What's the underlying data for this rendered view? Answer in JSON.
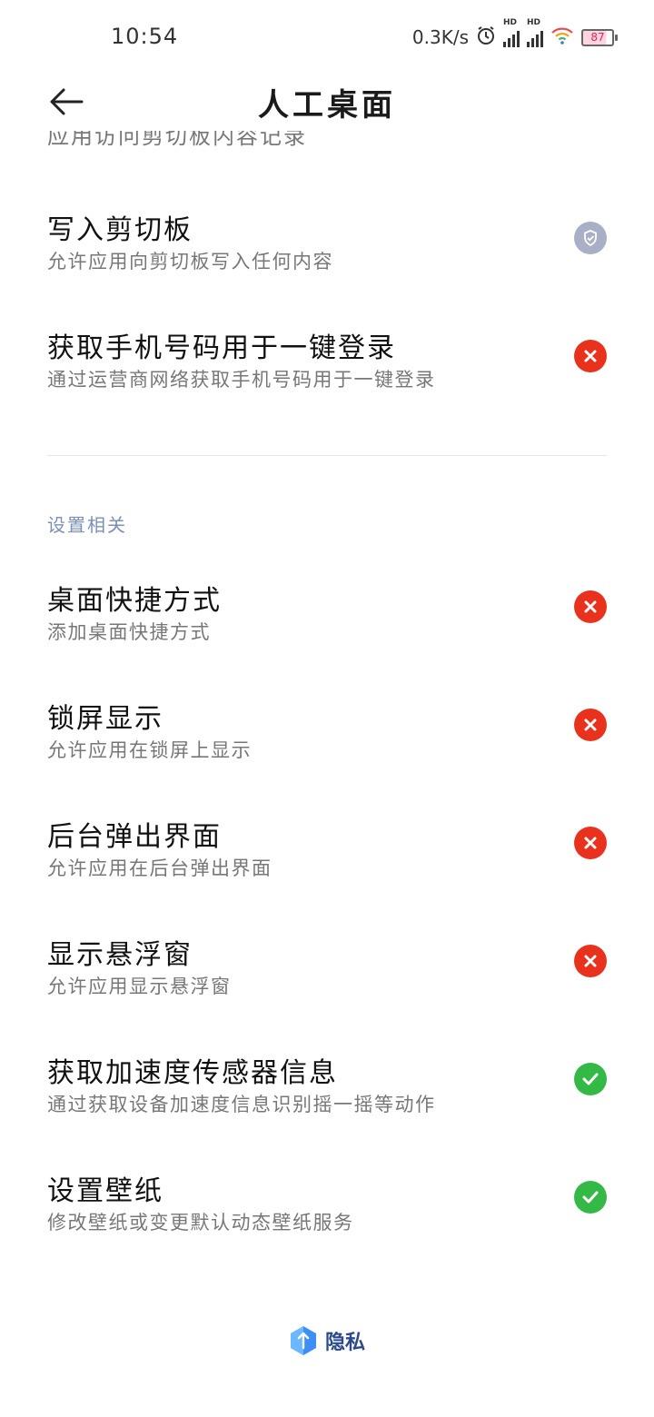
{
  "status_bar": {
    "time": "10:54",
    "net_speed": "0.3K/s",
    "signal_label": "HD",
    "battery": "87",
    "icons": [
      "alarm-icon",
      "signal-icon",
      "signal-icon",
      "wifi-icon",
      "battery-icon"
    ]
  },
  "header": {
    "back_icon": "arrow-left-icon",
    "title": "人工桌面"
  },
  "truncated_text": "应用访问剪切板内容记录",
  "permissions": [
    {
      "title": "写入剪切板",
      "subtitle": "允许应用向剪切板写入任何内容",
      "status": "ask"
    },
    {
      "title": "获取手机号码用于一键登录",
      "subtitle": "通过运营商网络获取手机号码用于一键登录",
      "status": "denied"
    }
  ],
  "section": {
    "label": "设置相关",
    "items": [
      {
        "title": "桌面快捷方式",
        "subtitle": "添加桌面快捷方式",
        "status": "denied"
      },
      {
        "title": "锁屏显示",
        "subtitle": "允许应用在锁屏上显示",
        "status": "denied"
      },
      {
        "title": "后台弹出界面",
        "subtitle": "允许应用在后台弹出界面",
        "status": "denied"
      },
      {
        "title": "显示悬浮窗",
        "subtitle": "允许应用显示悬浮窗",
        "status": "denied"
      },
      {
        "title": "获取加速度传感器信息",
        "subtitle": "通过获取设备加速度信息识别摇一摇等动作",
        "status": "allowed"
      },
      {
        "title": "设置壁纸",
        "subtitle": "修改壁纸或变更默认动态壁纸服务",
        "status": "allowed"
      }
    ]
  },
  "footer": {
    "label": "隐私",
    "icon": "privacy-shield-icon"
  },
  "colors": {
    "denied": "#e8321e",
    "allowed": "#34b846",
    "ask": "#a9b0c6",
    "section_label": "#7b8fb8",
    "footer_text": "#2b4a8c"
  }
}
